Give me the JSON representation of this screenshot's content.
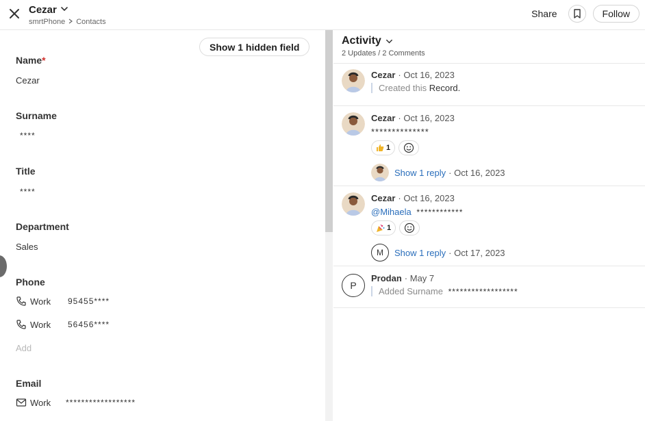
{
  "header": {
    "title": "Cezar",
    "breadcrumb": [
      "smrtPhone",
      "Contacts"
    ],
    "share_label": "Share",
    "follow_label": "Follow"
  },
  "left": {
    "hidden_field_label": "Show 1 hidden field",
    "name": {
      "label": "Name",
      "required_mark": "*",
      "value": "Cezar"
    },
    "surname": {
      "label": "Surname",
      "value": "****"
    },
    "title": {
      "label": "Title",
      "value": "****"
    },
    "department": {
      "label": "Department",
      "value": "Sales"
    },
    "phone": {
      "label": "Phone",
      "items": [
        {
          "kind": "Work",
          "value": "95455****"
        },
        {
          "kind": "Work",
          "value": "56456****"
        }
      ],
      "add_label": "Add"
    },
    "email": {
      "label": "Email",
      "items": [
        {
          "kind": "Work",
          "value": "******************"
        }
      ]
    }
  },
  "activity": {
    "title": "Activity",
    "subtitle": "2 Updates / 2 Comments",
    "entries": [
      {
        "author": "Cezar",
        "date": "· Oct 16, 2023",
        "text_muted": "Created this",
        "text_dark": "Record."
      },
      {
        "author": "Cezar",
        "date": "· Oct 16, 2023",
        "text": "**************",
        "reaction_count": "1",
        "reply_label": "Show 1 reply",
        "reply_date": "· Oct 16, 2023"
      },
      {
        "author": "Cezar",
        "date": "· Oct 16, 2023",
        "mention": "@Mihaela",
        "text": "************",
        "reaction_count": "1",
        "reply_avatar_letter": "M",
        "reply_label": "Show 1 reply",
        "reply_date": "· Oct 17, 2023"
      },
      {
        "author": "Prodan",
        "date": "· May 7",
        "avatar_letter": "P",
        "text_muted": "Added Surname",
        "text_dark": "******************"
      }
    ]
  },
  "colors": {
    "link": "#2a6ebb",
    "required": "#d0312d",
    "quote_border": "#cbd6e6"
  }
}
